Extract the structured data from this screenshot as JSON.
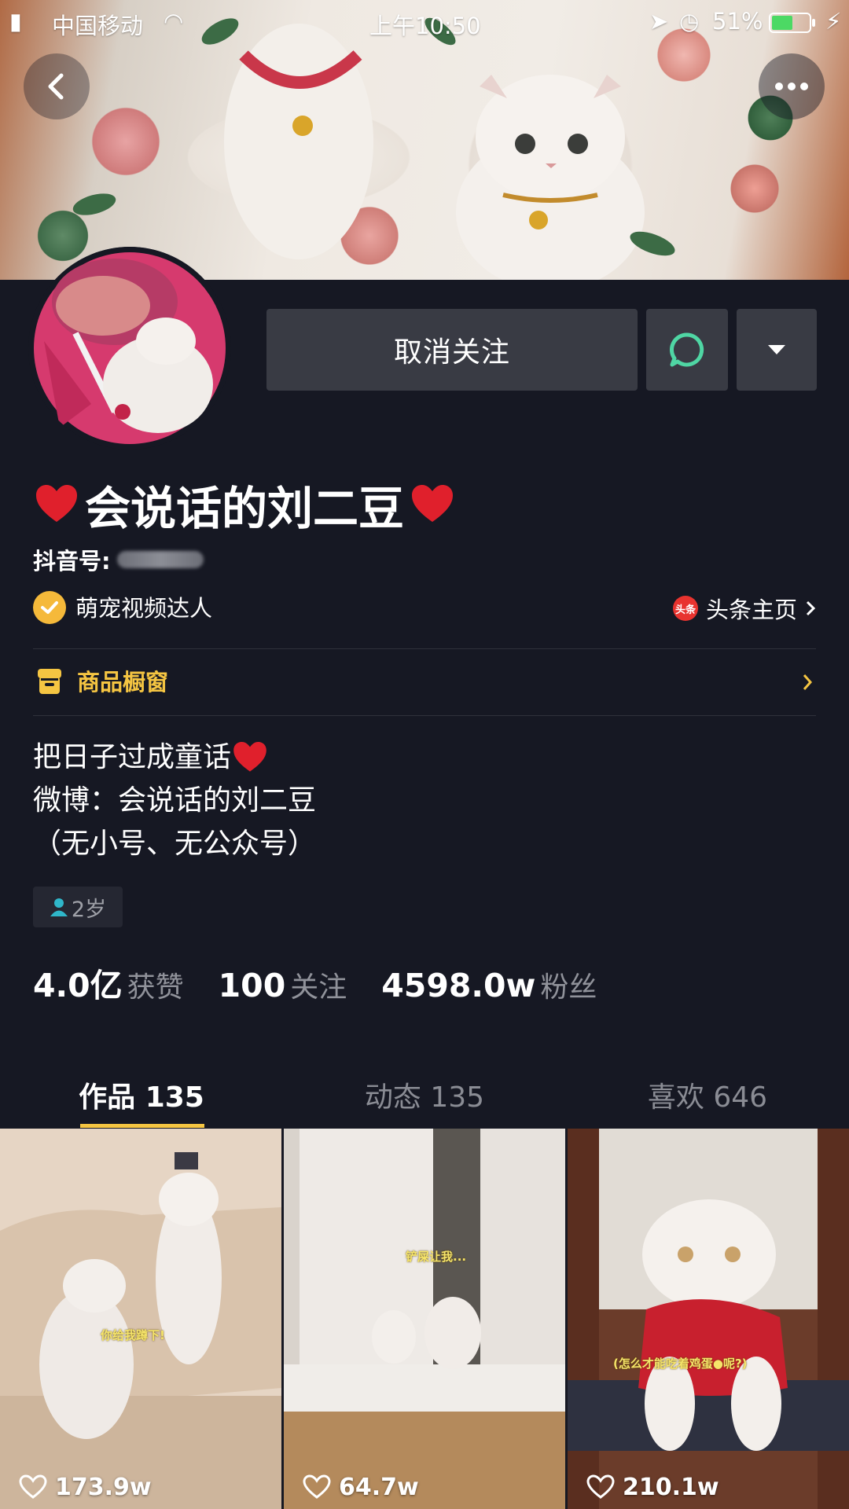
{
  "status_bar": {
    "carrier": "中国移动",
    "time": "上午10:50",
    "battery": "51%"
  },
  "header": {
    "follow_button": "取消关注"
  },
  "profile": {
    "nickname": "会说话的刘二豆",
    "douyin_id_label": "抖音号:",
    "verification": "萌宠视频达人",
    "toutiao_label": "头条主页",
    "toutiao_icon_text": "头条",
    "shop_label": "商品橱窗",
    "bio_lines": [
      "把日子过成童话",
      "微博：会说话的刘二豆",
      "（无小号、无公众号）"
    ],
    "age_tag": "2岁"
  },
  "stats": [
    {
      "value": "4.0亿",
      "label": "获赞"
    },
    {
      "value": "100",
      "label": "关注"
    },
    {
      "value": "4598.0w",
      "label": "粉丝"
    }
  ],
  "tabs": [
    {
      "label": "作品 135",
      "active": true
    },
    {
      "label": "动态 135",
      "active": false
    },
    {
      "label": "喜欢 646",
      "active": false
    }
  ],
  "videos": [
    {
      "likes": "173.9w",
      "caption": "你给我蹲下!"
    },
    {
      "likes": "64.7w",
      "caption": "铲屎让我..."
    },
    {
      "likes": "210.1w",
      "caption": "(怎么才能吃着鸡蛋●呢?)"
    }
  ],
  "colors": {
    "background": "#161823",
    "button": "#393b44",
    "accent_yellow": "#f5c542",
    "message_ring": "#4fd6a4",
    "verify_badge": "#f5b93a"
  },
  "icons": [
    "back-icon",
    "more-icon",
    "message-icon",
    "dropdown-icon",
    "verify-check-icon",
    "toutiao-icon",
    "shop-icon",
    "chevron-right-icon",
    "person-icon",
    "heart-outline-icon"
  ]
}
